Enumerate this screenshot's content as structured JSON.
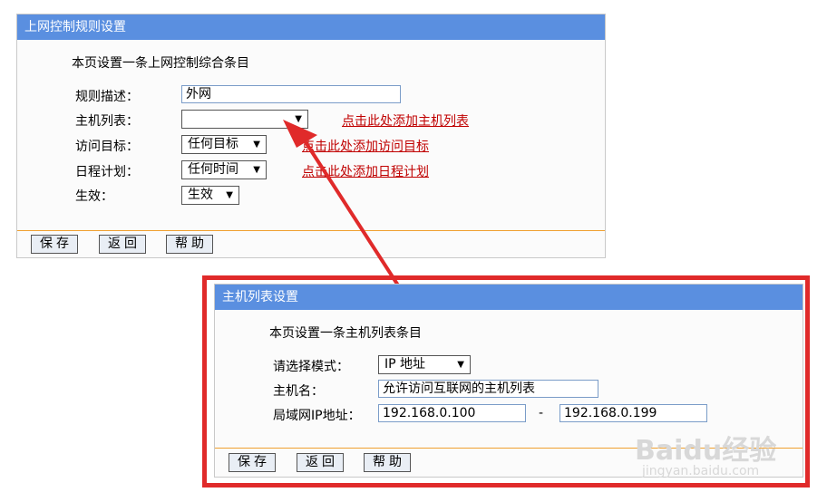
{
  "panel1": {
    "title": "上网控制规则设置",
    "description": "本页设置一条上网控制综合条目",
    "rule_desc_label": "规则描述：",
    "rule_desc_value": "外网",
    "host_list_label": "主机列表：",
    "host_list_value": "",
    "host_list_link": "点击此处添加主机列表",
    "target_label": "访问目标：",
    "target_value": "任何目标",
    "target_link": "点击此处添加访问目标",
    "schedule_label": "日程计划：",
    "schedule_value": "任何时间",
    "schedule_link": "点击此处添加日程计划",
    "effect_label": "生效：",
    "effect_value": "生效",
    "save": "保存",
    "back": "返回",
    "help": "帮助"
  },
  "panel2": {
    "title": "主机列表设置",
    "description": "本页设置一条主机列表条目",
    "mode_label": "请选择模式：",
    "mode_value": "IP 地址",
    "hostname_label": "主机名：",
    "hostname_value": "允许访问互联网的主机列表",
    "ip_label": "局域网IP地址：",
    "ip_start": "192.168.0.100",
    "ip_separator": "-",
    "ip_end": "192.168.0.199",
    "save": "保存",
    "back": "返回",
    "help": "帮助"
  },
  "watermark": {
    "brand": "Baidu经验",
    "url": "jingyan.baidu.com"
  },
  "colors": {
    "titlebar": "#5a8fe0",
    "link": "#c00000",
    "highlight": "#e02a2a",
    "footer_line": "#f0a030"
  }
}
